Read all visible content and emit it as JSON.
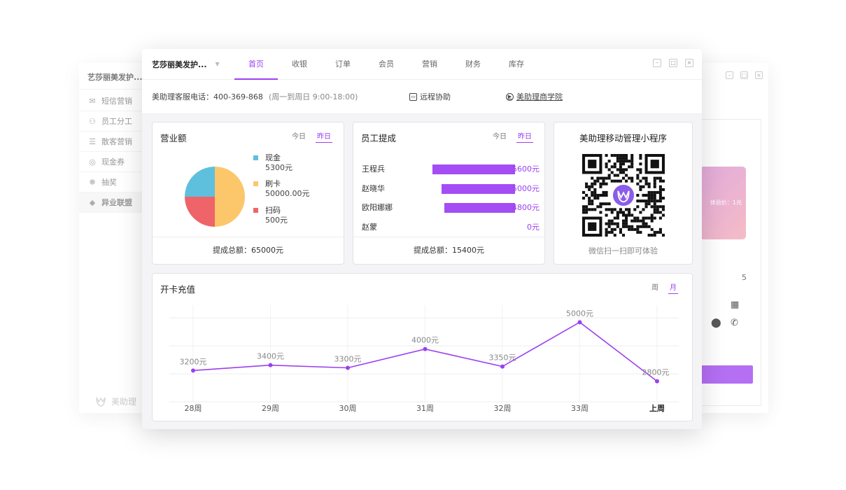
{
  "bg_left": {
    "title": "艺莎丽美发护...",
    "nav": [
      {
        "icon": "mail-icon",
        "glyph": "✉",
        "label": "短信营销"
      },
      {
        "icon": "staff-icon",
        "glyph": "⚇",
        "label": "员工分工"
      },
      {
        "icon": "database-icon",
        "glyph": "☰",
        "label": "散客营销"
      },
      {
        "icon": "coupon-icon",
        "glyph": "◎",
        "label": "现金券"
      },
      {
        "icon": "gift-icon",
        "glyph": "❋",
        "label": "抽奖"
      },
      {
        "icon": "diamond-icon",
        "glyph": "◆",
        "label": "异业联盟"
      }
    ],
    "logo_text": "美助理"
  },
  "bg_right": {
    "card_price": "体验价：1元",
    "value_fragment": "5"
  },
  "header": {
    "shop_name": "艺莎丽美发护...",
    "tabs": [
      "首页",
      "收银",
      "订单",
      "会员",
      "营销",
      "财务",
      "库存"
    ],
    "active_tab": "首页"
  },
  "service": {
    "phone_label": "美助理客服电话：400-369-868",
    "hours": "(周一到周日 9:00-18:00)",
    "remote": "远程协助",
    "academy": "美助理商学院"
  },
  "revenue": {
    "title": "营业额",
    "tabs": [
      "今日",
      "昨日"
    ],
    "active": "昨日",
    "footer": "提成总额：65000元",
    "legend": [
      {
        "name": "现金",
        "value": "5300元",
        "color": "#5ec0dc"
      },
      {
        "name": "刷卡",
        "value": "50000.00元",
        "color": "#fcc76b"
      },
      {
        "name": "扫码",
        "value": "500元",
        "color": "#ee6468"
      }
    ]
  },
  "commission": {
    "title": "员工提成",
    "tabs": [
      "今日",
      "昨日"
    ],
    "active": "昨日",
    "footer": "提成总额：15400元",
    "employees": [
      {
        "name": "王程兵",
        "value": "5600元",
        "amount": 5600
      },
      {
        "name": "赵晓华",
        "value": "5000元",
        "amount": 5000
      },
      {
        "name": "欧阳娜娜",
        "value": "4800元",
        "amount": 4800
      },
      {
        "name": "赵蒙",
        "value": "0元",
        "amount": 0
      }
    ]
  },
  "mini": {
    "title": "美助理移动管理小程序",
    "caption": "微信扫一扫即可体验"
  },
  "recharge": {
    "title": "开卡充值",
    "tabs": [
      "周",
      "月"
    ],
    "active": "月"
  },
  "chart_data": {
    "type": "line",
    "title": "开卡充值",
    "categories": [
      "28周",
      "29周",
      "30周",
      "31周",
      "32周",
      "33周",
      "上周"
    ],
    "series": [
      {
        "values": [
          3200,
          3400,
          3300,
          4000,
          3350,
          5000,
          2800
        ],
        "labels": [
          "3200元",
          "3400元",
          "3300元",
          "4000元",
          "3350元",
          "5000元",
          "2800元"
        ]
      }
    ],
    "ylim": [
      0,
      6000
    ],
    "grid": true,
    "color": "#9b40f0"
  }
}
